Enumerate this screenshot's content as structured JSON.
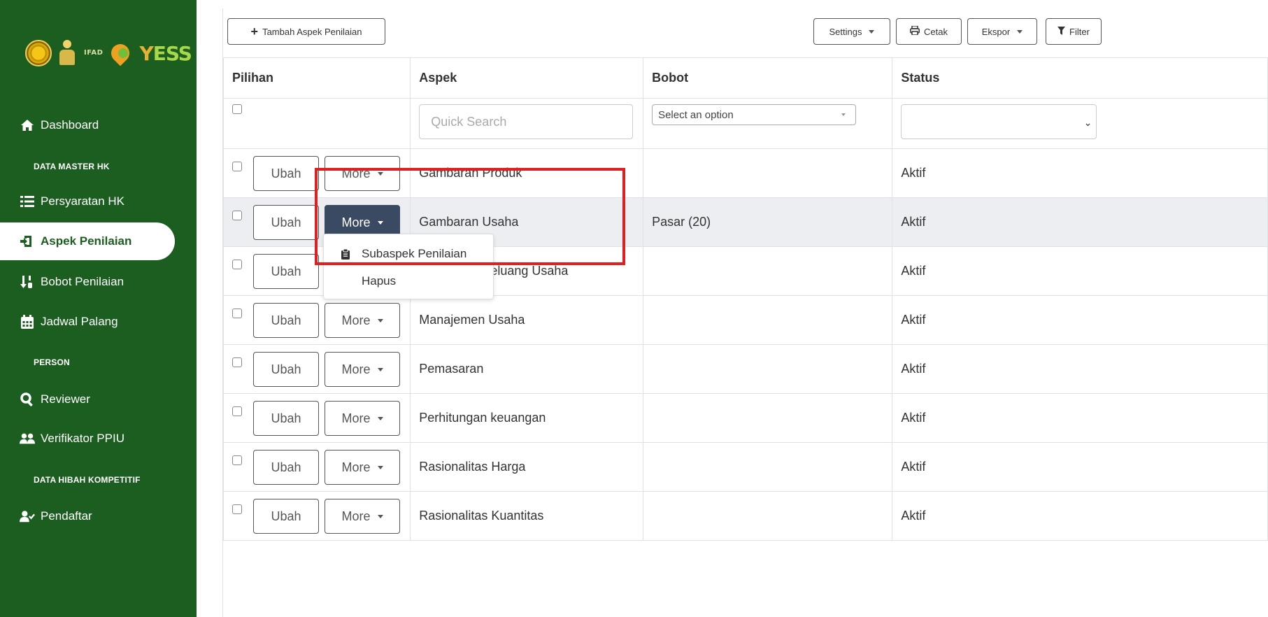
{
  "sidebar": {
    "logo_text": "IFAD",
    "logo_brand": "YESS",
    "items": [
      {
        "label": "Dashboard",
        "icon": "home-icon"
      },
      {
        "label": "Persyaratan HK",
        "icon": "list-icon"
      },
      {
        "label": "Aspek Penilaian",
        "icon": "sign-in-icon",
        "active": true
      },
      {
        "label": "Bobot Penilaian",
        "icon": "sort-numeric-icon"
      },
      {
        "label": "Jadwal Palang",
        "icon": "calendar-icon"
      },
      {
        "label": "Reviewer",
        "icon": "search-icon"
      },
      {
        "label": "Verifikator PPIU",
        "icon": "users-icon"
      },
      {
        "label": "Pendaftar",
        "icon": "user-check-icon"
      }
    ],
    "sections": {
      "data_master": "DATA MASTER HK",
      "person": "PERSON",
      "data_hibah": "DATA HIBAH KOMPETITIF"
    },
    "color": "#1b5e20"
  },
  "toolbar": {
    "add_label": "Tambah Aspek Penilaian",
    "settings_label": "Settings",
    "print_label": "Cetak",
    "export_label": "Ekspor",
    "filter_label": "Filter"
  },
  "table": {
    "headers": {
      "pilihan": "Pilihan",
      "aspek": "Aspek",
      "bobot": "Bobot",
      "status": "Status"
    },
    "quick_search_placeholder": "Quick Search",
    "bobot_select": "Select an option",
    "ubah_label": "Ubah",
    "more_label": "More",
    "rows": [
      {
        "aspek": "Gambaran Produk",
        "bobot": "",
        "status": "Aktif"
      },
      {
        "aspek": "Gambaran Usaha",
        "bobot": "Pasar (20)",
        "status": "Aktif"
      },
      {
        "aspek": "Gambaran Peluang Usaha",
        "bobot": "",
        "status": "Aktif"
      },
      {
        "aspek": "Manajemen Usaha",
        "bobot": "",
        "status": "Aktif"
      },
      {
        "aspek": "Pemasaran",
        "bobot": "",
        "status": "Aktif"
      },
      {
        "aspek": "Perhitungan keuangan",
        "bobot": "",
        "status": "Aktif"
      },
      {
        "aspek": "Rasionalitas Harga",
        "bobot": "",
        "status": "Aktif"
      },
      {
        "aspek": "Rasionalitas Kuantitas",
        "bobot": "",
        "status": "Aktif"
      }
    ]
  },
  "dropdown": {
    "items": [
      {
        "label": "Subaspek Penilaian",
        "icon": "clipboard-icon"
      },
      {
        "label": "Hapus",
        "icon": ""
      }
    ]
  },
  "highlight_color": "#e02020"
}
